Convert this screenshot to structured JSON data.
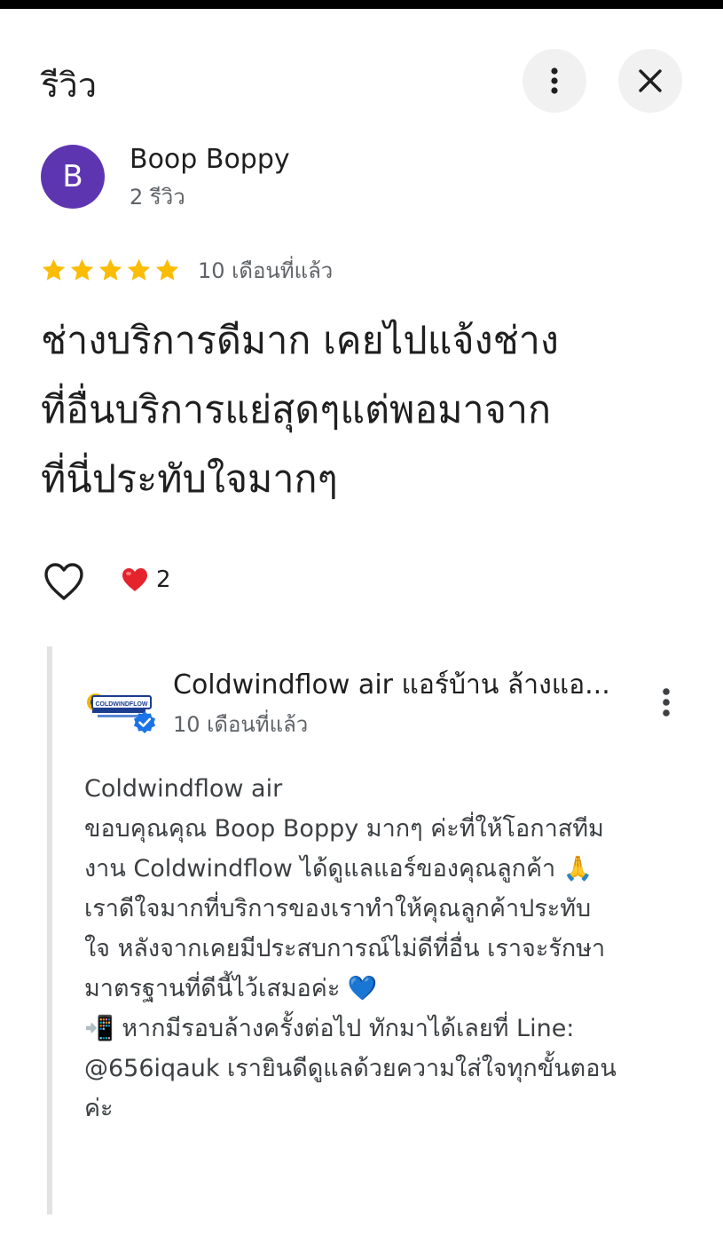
{
  "header": {
    "title": "รีวิว",
    "more_icon": "more-vert-icon",
    "close_icon": "close-icon"
  },
  "author": {
    "avatar_letter": "B",
    "avatar_color": "#5e35b1",
    "name": "Boop Boppy",
    "meta": "2 รีวิว"
  },
  "rating": {
    "stars": 5,
    "max_stars": 5,
    "star_color": "#fbbc04",
    "time": "10 เดือนที่แล้ว"
  },
  "review": {
    "text_lines": [
      "ช่างบริการดีมาก เคยไปแจ้งช่าง",
      "ที่อื่นบริการแย่สุดๆแต่พอมาจาก",
      "ที่นี่ประทับใจมากๆ"
    ]
  },
  "reactions": {
    "like_icon": "heart-outline-icon",
    "count_icon": "red-heart-emoji-icon",
    "count": "2"
  },
  "owner_reply": {
    "logo_text": "COLDWINDFLOW",
    "name": "Coldwindflow air แอร์บ้าน ล้างแอ...",
    "time": "10 เดือนที่แล้ว",
    "lines": [
      "Coldwindflow air",
      "ขอบคุณคุณ Boop Boppy มากๆ ค่ะที่ให้โอกาสทีม",
      "งาน Coldwindflow ได้ดูแลแอร์ของคุณลูกค้า 🙏",
      "เราดีใจมากที่บริการของเราทำให้คุณลูกค้าประทับ",
      "ใจ หลังจากเคยมีประสบการณ์ไม่ดีที่อื่น เราจะรักษา",
      "มาตรฐานที่ดีนี้ไว้เสมอค่ะ 💙",
      "📲 หากมีรอบล้างครั้งต่อไป ทักมาได้เลยที่ Line:",
      "@656iqauk เรายินดีดูแลด้วยความใส่ใจทุกขั้นตอน",
      "ค่ะ"
    ]
  }
}
